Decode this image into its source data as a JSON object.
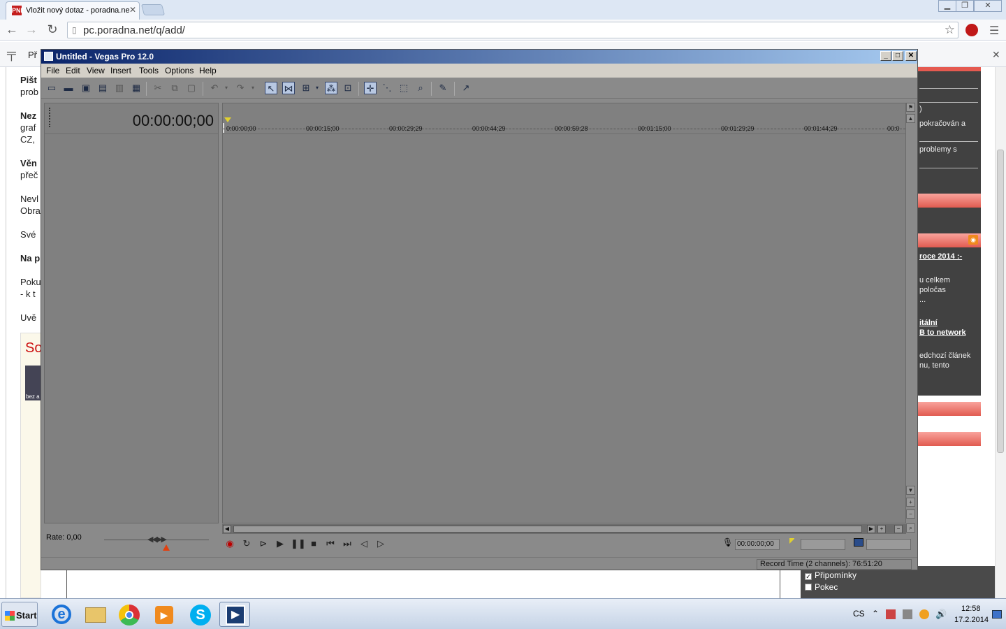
{
  "browser": {
    "tab_title": "Vložit nový dotaz - poradna.net",
    "tab_icon": "PNET",
    "url": "pc.poradna.net/q/add/",
    "bookmark_text": "Př"
  },
  "page": {
    "lines": [
      {
        "text": "Pišt",
        "bold": true
      },
      {
        "text": "prob",
        "bold": false
      },
      {
        "text": "Nez",
        "bold": true
      },
      {
        "text": "graf",
        "bold": false
      },
      {
        "text": "CZ,",
        "bold": false
      },
      {
        "text": "Věn",
        "bold": true
      },
      {
        "text": "přeč",
        "bold": false
      },
      {
        "text": "Nevl",
        "bold": false
      },
      {
        "text": "Obra",
        "bold": false
      },
      {
        "text": "Své",
        "bold": false
      },
      {
        "text": "Na p",
        "bold": true
      },
      {
        "text": "Poku",
        "bold": false
      },
      {
        "text": "- k t",
        "bold": false
      },
      {
        "text": "Uvě",
        "bold": false
      }
    ],
    "box_letter": "So",
    "box_caption": "bez a",
    "right_texts": [
      ")",
      "pokračován a",
      "problemy s",
      "roce 2014 :-",
      "u celkem",
      "poločas",
      "...",
      "itální",
      "B to network",
      "edchozí článek",
      "nu, tento"
    ],
    "checkboxes": [
      {
        "label": "Připomínky",
        "checked": true
      },
      {
        "label": "Pokec",
        "checked": false
      }
    ]
  },
  "vegas": {
    "title": "Untitled - Vegas Pro 12.0",
    "menu": [
      "File",
      "Edit",
      "View",
      "Insert",
      "Tools",
      "Options",
      "Help"
    ],
    "time_display": "00:00:00;00",
    "ruler_ticks": [
      "0:00:00;00",
      "00:00:15;00",
      "00:00:29;29",
      "00:00:44;29",
      "00:00:59;28",
      "00:01:15;00",
      "00:01:29;29",
      "00:01:44;29",
      "00:0"
    ],
    "rate_label": "Rate: 0,00",
    "cursor_time": "00:00:00;00",
    "status": "Record Time (2 channels): 76:51:20"
  },
  "taskbar": {
    "start_label": "Start",
    "language": "CS",
    "time": "12:58",
    "date": "17.2.2014"
  }
}
